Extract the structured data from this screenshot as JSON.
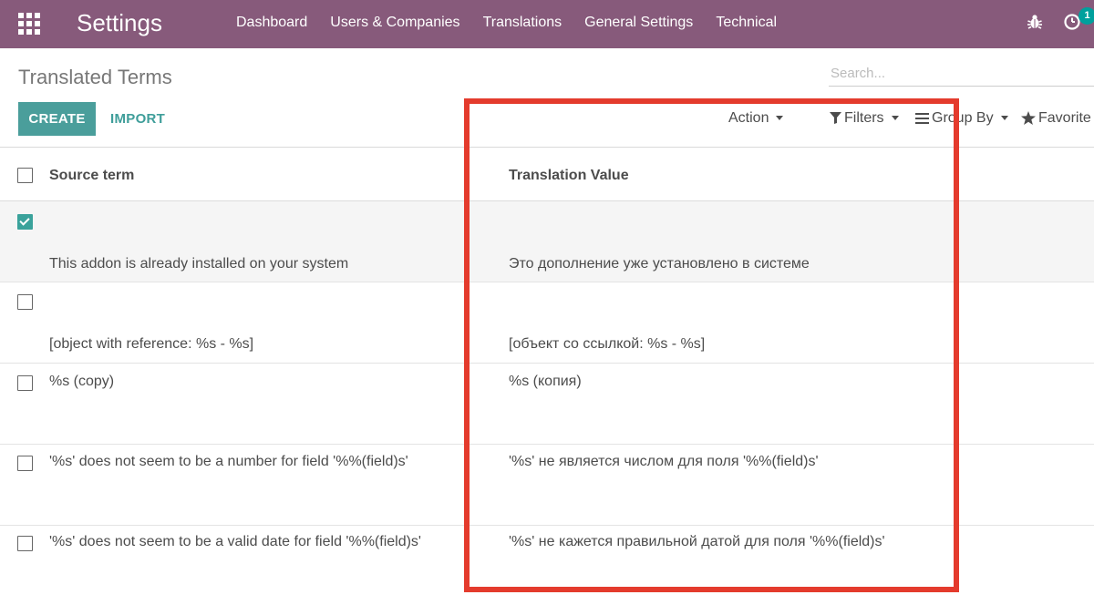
{
  "app": {
    "title": "Settings"
  },
  "nav": {
    "menu": [
      "Dashboard",
      "Users & Companies",
      "Translations",
      "General Settings",
      "Technical"
    ],
    "badge_count": "1"
  },
  "colors": {
    "navbar": "#875a7b",
    "primary": "#4a9e9b",
    "highlight": "#e43b2d"
  },
  "page": {
    "title": "Translated Terms"
  },
  "search": {
    "placeholder": "Search..."
  },
  "buttons": {
    "create": "CREATE",
    "import": "IMPORT"
  },
  "controls": {
    "action": "Action",
    "filters": "Filters",
    "group_by": "Group By",
    "favorites": "Favorite"
  },
  "table": {
    "columns": {
      "source": "Source term",
      "translation": "Translation Value"
    },
    "rows": [
      {
        "source": "This addon is already installed on your system",
        "translation": "Это дополнение уже установлено в системе",
        "checked": true
      },
      {
        "source": "[object with reference: %s - %s]",
        "translation": "[объект со ссылкой: %s - %s]",
        "checked": false
      },
      {
        "source": "%s (copy)",
        "translation": "%s (копия)",
        "checked": false
      },
      {
        "source": "'%s' does not seem to be a number for field '%%(field)s'",
        "translation": "'%s' не является числом для поля '%%(field)s'",
        "checked": false
      },
      {
        "source": "'%s' does not seem to be a valid date for field '%%(field)s'",
        "translation": "'%s' не кажется правильной датой для поля '%%(field)s'",
        "checked": false
      }
    ]
  }
}
